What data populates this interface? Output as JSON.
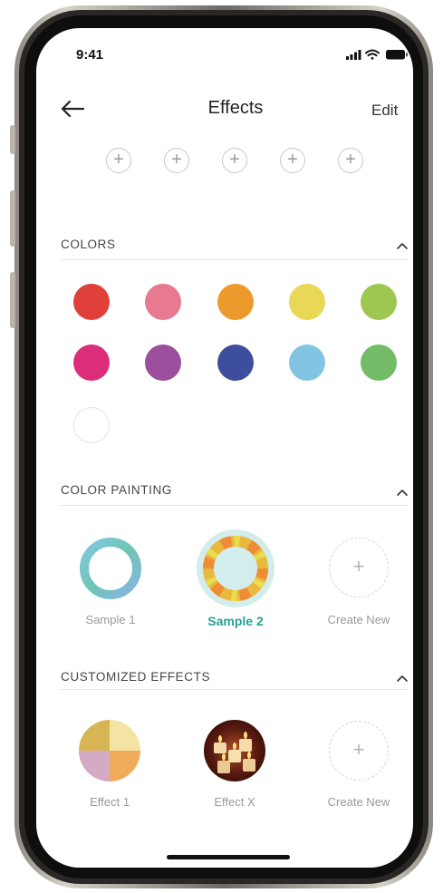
{
  "status_bar": {
    "time": "9:41"
  },
  "header": {
    "title": "Effects",
    "edit_label": "Edit"
  },
  "slots": [
    "+",
    "+",
    "+",
    "+",
    "+"
  ],
  "colors_section": {
    "title": "COLORS",
    "swatches": [
      "#e0403a",
      "#e77a90",
      "#ec9a2b",
      "#e9d756",
      "#9ec752",
      "#dc2d7a",
      "#9c4f9c",
      "#3d4e9c",
      "#82c5e3",
      "#73bb66",
      "#ffffff"
    ]
  },
  "color_painting": {
    "title": "COLOR PAINTING",
    "items": [
      {
        "label": "Sample 1",
        "selected": false
      },
      {
        "label": "Sample 2",
        "selected": true
      }
    ],
    "create_label": "Create New",
    "create_symbol": "+"
  },
  "customized_effects": {
    "title": "CUSTOMIZED EFFECTS",
    "items": [
      {
        "label": "Effect 1",
        "icon": "quad-color-icon"
      },
      {
        "label": "Effect X",
        "icon": "candles-photo-icon"
      }
    ],
    "create_label": "Create New",
    "create_symbol": "+"
  },
  "accent_color": "#23a394"
}
